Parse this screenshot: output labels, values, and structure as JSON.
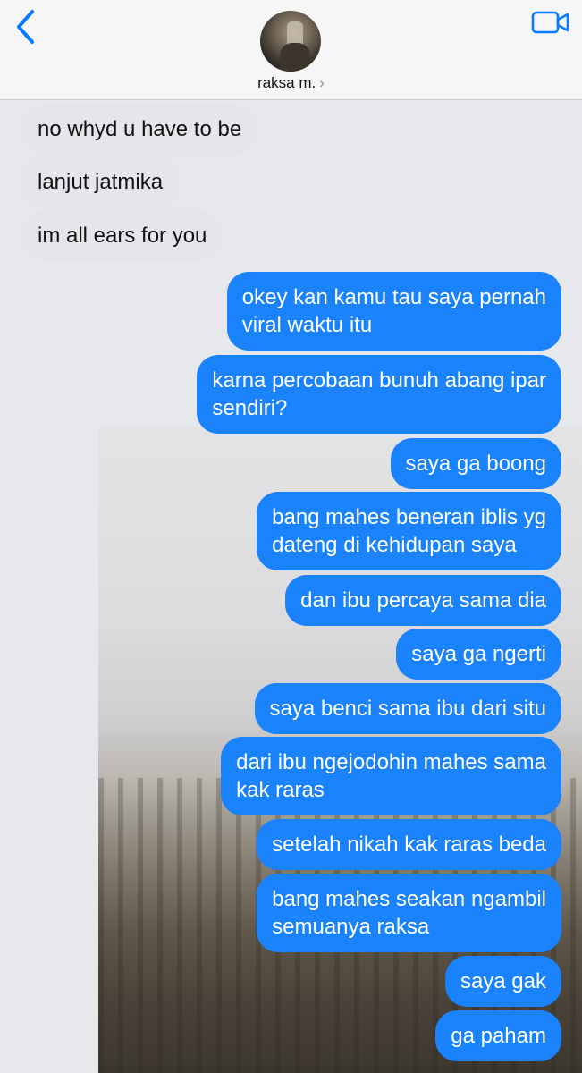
{
  "header": {
    "contact_name": "raksa m.",
    "chevron": "›",
    "back_icon": "back-chevron-icon",
    "video_icon": "video-camera-icon"
  },
  "colors": {
    "outgoing_bubble": "#1a82fb",
    "incoming_bubble": "#e5e5ea",
    "ios_blue": "#0a7cff"
  },
  "messages": [
    {
      "direction": "in",
      "text": "no whyd u have to be"
    },
    {
      "direction": "in",
      "text": "lanjut jatmika"
    },
    {
      "direction": "in",
      "text": "im all ears for you"
    },
    {
      "direction": "out",
      "text": "okey kan kamu tau saya pernah\nviral waktu itu"
    },
    {
      "direction": "out",
      "text": "karna percobaan bunuh abang ipar\nsendiri?"
    },
    {
      "direction": "out",
      "text": "saya ga boong"
    },
    {
      "direction": "out",
      "text": "bang mahes beneran iblis yg\ndateng di kehidupan saya"
    },
    {
      "direction": "out",
      "text": "dan ibu percaya sama dia"
    },
    {
      "direction": "out",
      "text": "saya ga ngerti"
    },
    {
      "direction": "out",
      "text": "saya benci sama ibu dari situ"
    },
    {
      "direction": "out",
      "text": "dari ibu ngejodohin mahes sama\nkak raras"
    },
    {
      "direction": "out",
      "text": "setelah nikah kak raras beda"
    },
    {
      "direction": "out",
      "text": "bang mahes seakan ngambil\nsemuanya raksa"
    },
    {
      "direction": "out",
      "text": "saya gak"
    },
    {
      "direction": "out",
      "text": "ga paham"
    }
  ]
}
